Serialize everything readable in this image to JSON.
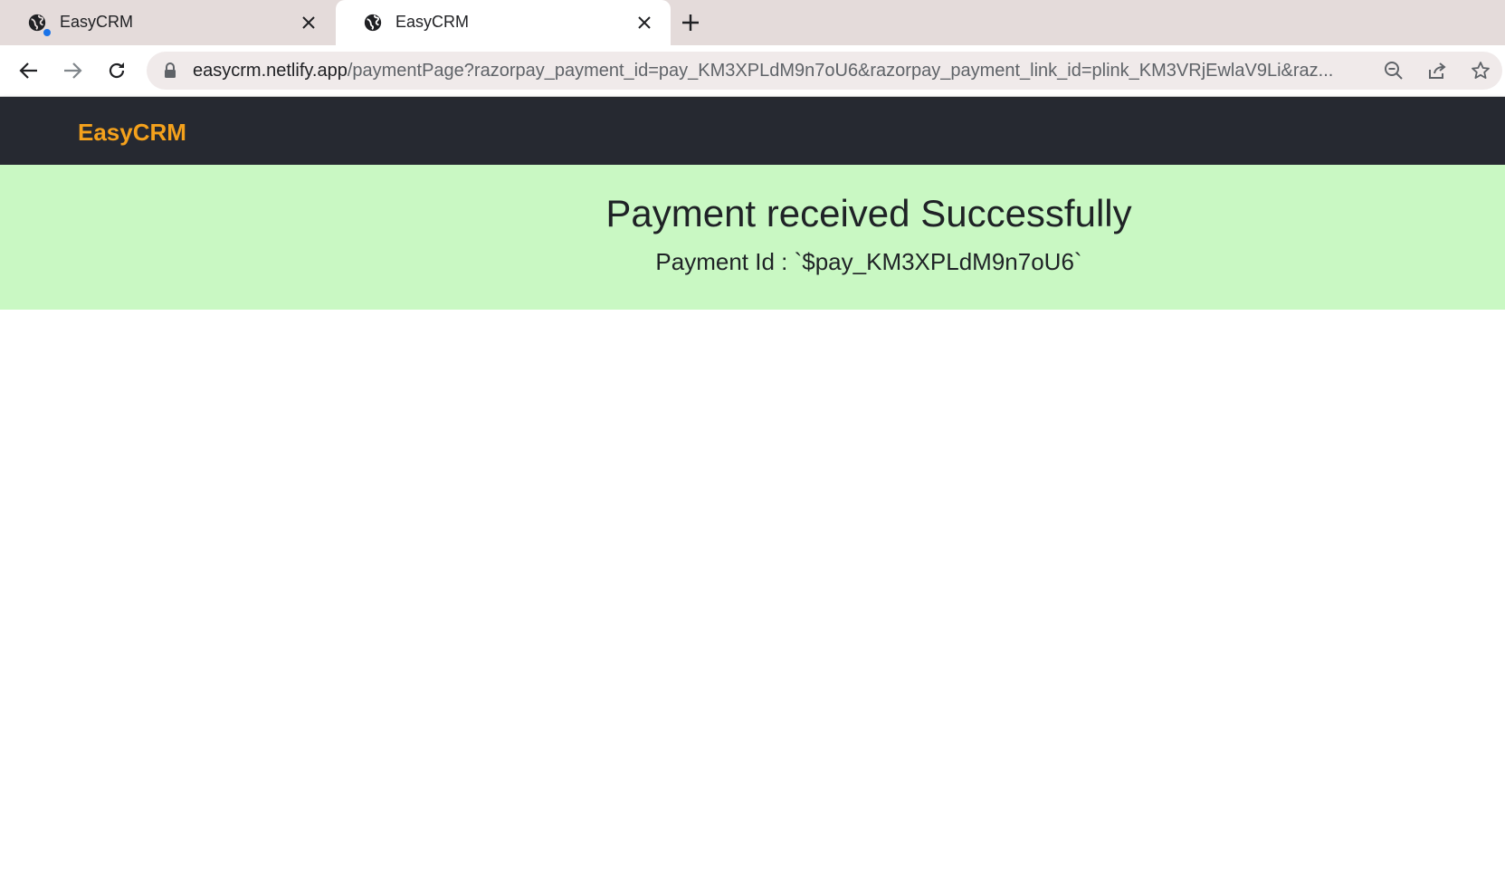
{
  "browser": {
    "tabs": [
      {
        "label": "EasyCRM",
        "active": false,
        "icon": "globe-icon",
        "status_dot_color": "#1a73e8"
      },
      {
        "label": "EasyCRM",
        "active": true,
        "icon": "globe-icon"
      }
    ],
    "new_tab_icon": "plus-icon",
    "nav": {
      "back_icon": "arrow-left-icon",
      "forward_icon": "arrow-right-icon",
      "reload_icon": "reload-icon"
    },
    "address": {
      "lock_icon": "lock-icon",
      "host": "easycrm.netlify.app",
      "path": "/paymentPage?razorpay_payment_id=pay_KM3XPLdM9n7oU6&razorpay_payment_link_id=plink_KM3VRjEwlaV9Li&raz..."
    },
    "omnibox_icons": [
      "zoom-icon",
      "share-icon",
      "star-icon"
    ]
  },
  "app": {
    "brand": "EasyCRM",
    "brand_color": "#f4a11c",
    "navbar_color": "#262931"
  },
  "banner": {
    "heading": "Payment received Successfully",
    "payment_id_text": "Payment Id : `$pay_KM3XPLdM9n7oU6`",
    "background": "#c9f8c3"
  }
}
